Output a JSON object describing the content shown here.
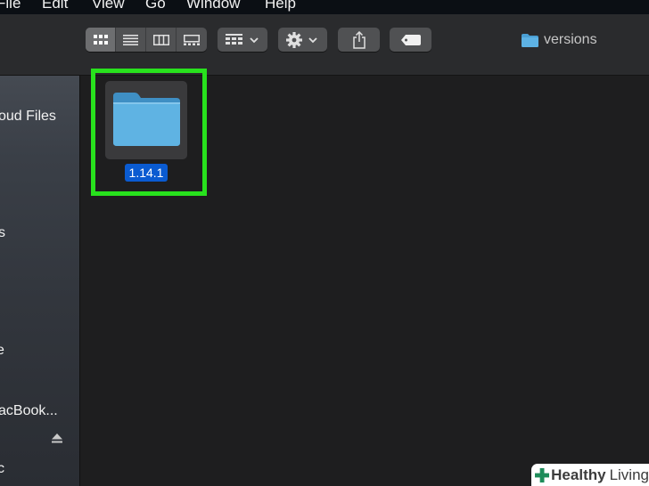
{
  "menubar": {
    "items": [
      "File",
      "Edit",
      "View",
      "Go",
      "Window",
      "Help"
    ]
  },
  "window": {
    "title": "versions",
    "title_icon": "folder-icon"
  },
  "toolbar": {
    "view_modes": [
      "icon-view",
      "list-view",
      "column-view",
      "gallery-view"
    ],
    "active_view": "icon-view",
    "group_button_icon": "group-by-icon",
    "action_button_icon": "gear-icon",
    "share_button_icon": "share-icon",
    "tag_button_icon": "tag-icon"
  },
  "sidebar": {
    "items": [
      {
        "label": "oud Files"
      },
      {
        "label": "s"
      },
      {
        "label": "e"
      },
      {
        "label": "acBook..."
      },
      {
        "label": "c"
      }
    ],
    "eject_icon": "eject-icon"
  },
  "content": {
    "items": [
      {
        "name": "1.14.1",
        "type": "folder",
        "selected": true
      }
    ]
  },
  "watermark": {
    "text_bold": "Healthy",
    "text_regular": "Living"
  },
  "colors": {
    "highlight": "#28e21d",
    "selection": "#0a5bd1",
    "folder": "#5fb3e3",
    "background": "#1e1e1f"
  }
}
